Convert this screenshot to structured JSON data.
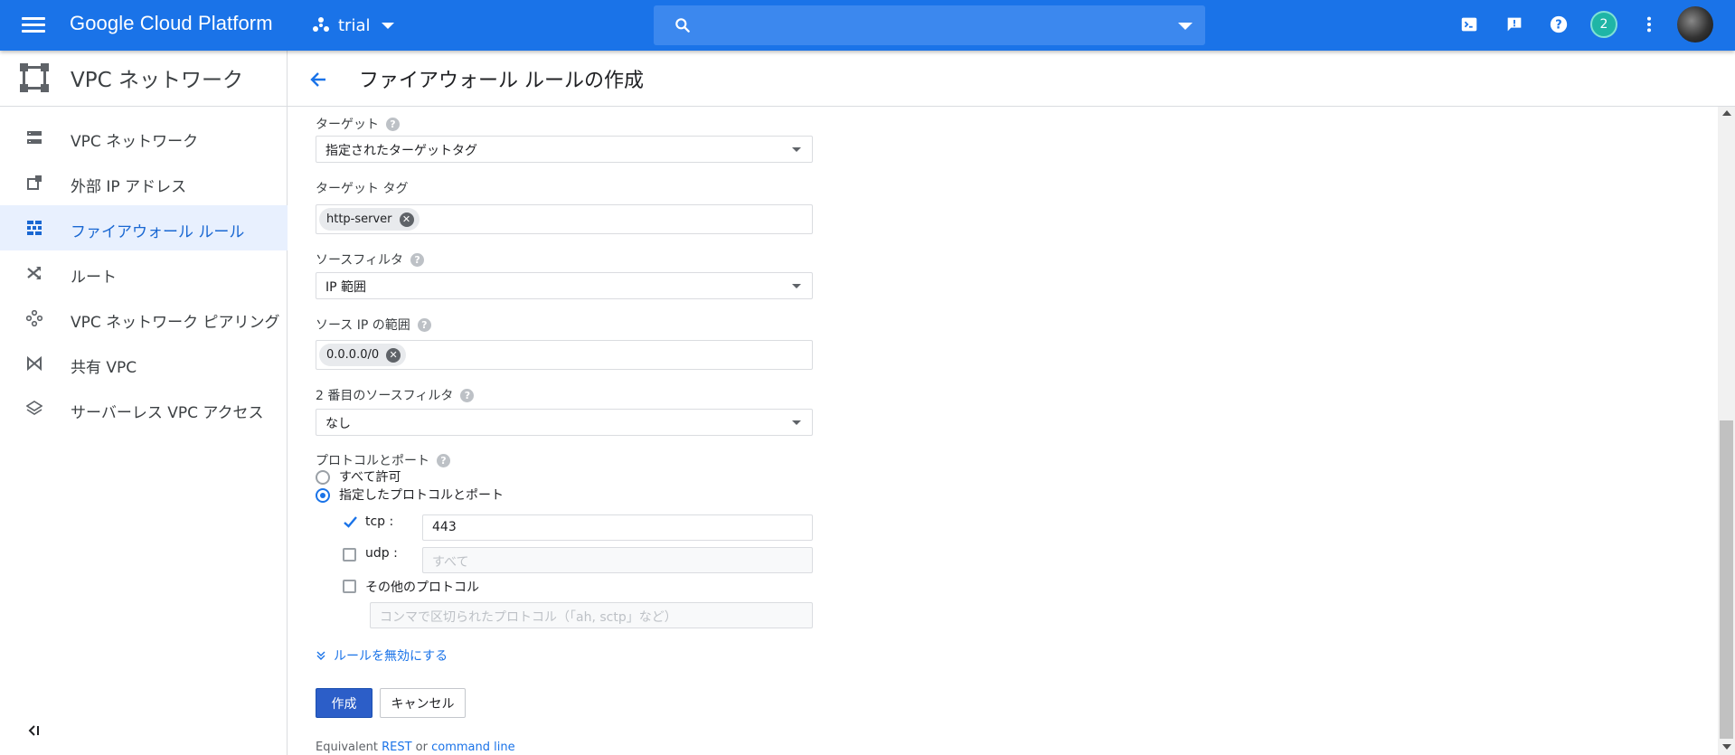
{
  "topbar": {
    "brand": "Google Cloud Platform",
    "project": "trial",
    "notifications_count": "2",
    "accent": "#1a73e8"
  },
  "sidebar": {
    "title": "VPC ネットワーク",
    "items": [
      {
        "label": "VPC ネットワーク",
        "icon": "vpc-network-icon"
      },
      {
        "label": "外部 IP アドレス",
        "icon": "external-ip-icon"
      },
      {
        "label": "ファイアウォール ルール",
        "icon": "firewall-icon",
        "active": true
      },
      {
        "label": "ルート",
        "icon": "routes-icon"
      },
      {
        "label": "VPC ネットワーク ピアリング",
        "icon": "peering-icon"
      },
      {
        "label": "共有 VPC",
        "icon": "shared-vpc-icon"
      },
      {
        "label": "サーバーレス VPC アクセス",
        "icon": "serverless-icon"
      }
    ]
  },
  "page": {
    "title": "ファイアウォール ルールの作成"
  },
  "form": {
    "target_label": "ターゲット",
    "target_value": "指定されたターゲットタグ",
    "target_tags_label": "ターゲット タグ",
    "target_tag_chip": "http-server",
    "source_filter_label": "ソースフィルタ",
    "source_filter_value": "IP 範囲",
    "source_ip_label": "ソース IP の範囲",
    "source_ip_chip": "0.0.0.0/0",
    "second_source_filter_label": "2 番目のソースフィルタ",
    "second_source_filter_value": "なし",
    "protocols_label": "プロトコルとポート",
    "allow_all_label": "すべて許可",
    "specified_label": "指定したプロトコルとポート",
    "tcp_label": "tcp :",
    "tcp_value": "443",
    "udp_label": "udp :",
    "udp_placeholder": "すべて",
    "other_label": "その他のプロトコル",
    "other_placeholder": "コンマで区切られたプロトコル（「ah, sctp」など）",
    "disable_rule_link": "ルールを無効にする",
    "create_button": "作成",
    "cancel_button": "キャンセル",
    "equivalent_prefix": "Equivalent",
    "rest_link": "REST",
    "or_text": "or",
    "command_line_link": "command line"
  }
}
